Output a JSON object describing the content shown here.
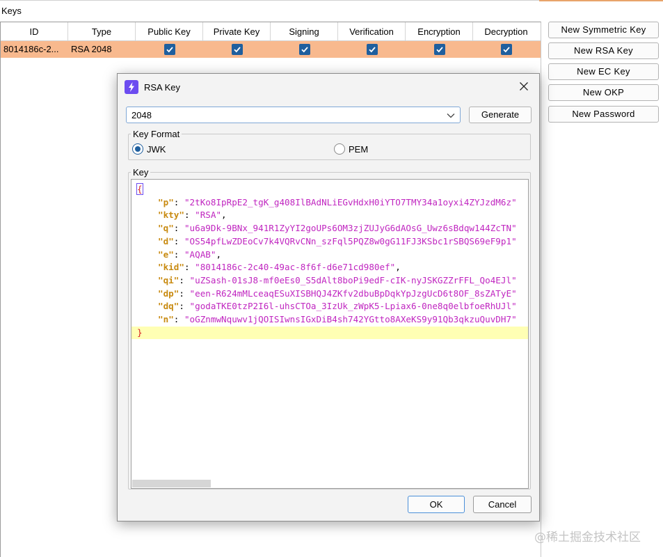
{
  "main": {
    "keys_label": "Keys",
    "columns": [
      "ID",
      "Type",
      "Public Key",
      "Private Key",
      "Signing",
      "Verification",
      "Encryption",
      "Decryption"
    ],
    "rows": [
      {
        "id": "8014186c-2...",
        "type": "RSA 2048",
        "public_key": true,
        "private_key": true,
        "signing": true,
        "verification": true,
        "encryption": true,
        "decryption": true
      }
    ],
    "row_highlight_color": "#f8b98e",
    "side_buttons": {
      "new_symmetric_key": "New Symmetric Key",
      "new_rsa_key": "New RSA Key",
      "new_ec_key": "New EC Key",
      "new_okp": "New OKP",
      "new_password": "New Password"
    }
  },
  "dialog": {
    "title": "RSA Key",
    "app_icon": "lightning-bolt-icon",
    "key_size": "2048",
    "generate_label": "Generate",
    "key_format_label": "Key Format",
    "formats": [
      {
        "label": "JWK",
        "selected": true
      },
      {
        "label": "PEM",
        "selected": false
      }
    ],
    "key_label": "Key",
    "json_open": "{",
    "json_close": "}",
    "json_lines": [
      {
        "key": "p",
        "value": "2tKo8IpRpE2_tgK_g408IlBAdNLiEGvHdxH0iYTO7TMY34a1oyxi4ZYJzdM6z"
      },
      {
        "key": "kty",
        "value": "RSA"
      },
      {
        "key": "q",
        "value": "u6a9Dk-9BNx_941R1ZyYI2goUPs6OM3zjZUJyG6dAOsG_Uwz6sBdqw144ZcTN"
      },
      {
        "key": "d",
        "value": "OS54pfLwZDEoCv7k4VQRvCNn_szFql5PQZ8w0gG11FJ3KSbc1rSBQS69eF9p1"
      },
      {
        "key": "e",
        "value": "AQAB"
      },
      {
        "key": "kid",
        "value": "8014186c-2c40-49ac-8f6f-d6e71cd980ef"
      },
      {
        "key": "qi",
        "value": "uZSash-01sJ8-mf0eEs0_S5dAlt8boPi9edF-cIK-nyJSKGZZrFFL_Qo4EJl"
      },
      {
        "key": "dp",
        "value": "een-R624mMLceaqESuXISBHQJ4ZKfv2dbuBpDqkYpJzgUcD6t8OF_8sZATyE"
      },
      {
        "key": "dq",
        "value": "godaTKE0tzP2I6l-uhsCTOa_3IzUk_zWpK5-Lpiax6-0ne8q0elbfoeRhUJl"
      },
      {
        "key": "n",
        "value": "oGZnmwNquwv1jQOISIwnsIGxDiB4sh742YGtto8AXeKS9y91Qb3qkzuQuvDH7"
      }
    ],
    "ok_label": "OK",
    "cancel_label": "Cancel"
  },
  "watermark": "@稀土掘金技术社区",
  "colors": {
    "accent": "#1f5f9e",
    "json_key": "#c88a10",
    "json_string": "#c026c0",
    "json_brace": "#d82020",
    "current_line": "#ffffb4"
  }
}
